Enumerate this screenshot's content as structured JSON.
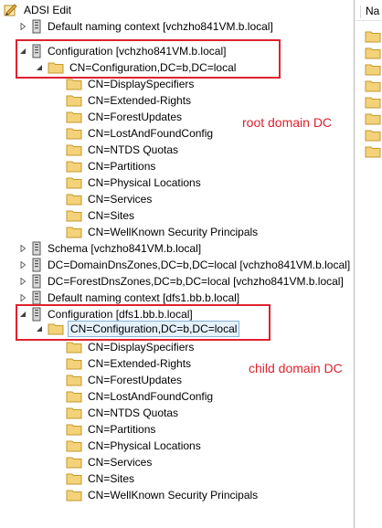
{
  "window": {
    "title": "ADSI Edit"
  },
  "right_pane": {
    "column_header": "Na"
  },
  "tree": {
    "root": "ADSI Edit",
    "n1": "Default naming context [vchzho841VM.b.local]",
    "n2": "Configuration [vchzho841VM.b.local]",
    "n3": "CN=Configuration,DC=b,DC=local",
    "g1": [
      "CN=DisplaySpecifiers",
      "CN=Extended-Rights",
      "CN=ForestUpdates",
      "CN=LostAndFoundConfig",
      "CN=NTDS Quotas",
      "CN=Partitions",
      "CN=Physical Locations",
      "CN=Services",
      "CN=Sites",
      "CN=WellKnown Security Principals"
    ],
    "n4": "Schema [vchzho841VM.b.local]",
    "n5": "DC=DomainDnsZones,DC=b,DC=local [vchzho841VM.b.local]",
    "n6": "DC=ForestDnsZones,DC=b,DC=local [vchzho841VM.b.local]",
    "n7": "Default naming context [dfs1.bb.b.local]",
    "n8": "Configuration [dfs1.bb.b.local]",
    "n9": "CN=Configuration,DC=b,DC=local",
    "g2": [
      "CN=DisplaySpecifiers",
      "CN=Extended-Rights",
      "CN=ForestUpdates",
      "CN=LostAndFoundConfig",
      "CN=NTDS Quotas",
      "CN=Partitions",
      "CN=Physical Locations",
      "CN=Services",
      "CN=Sites",
      "CN=WellKnown Security Principals"
    ]
  },
  "annotations": {
    "root_label": "root domain DC",
    "child_label": "child domain DC"
  },
  "colors": {
    "annotation": "#e0212e",
    "folder": "#f3d27a",
    "selection": "#e5f1fb"
  }
}
